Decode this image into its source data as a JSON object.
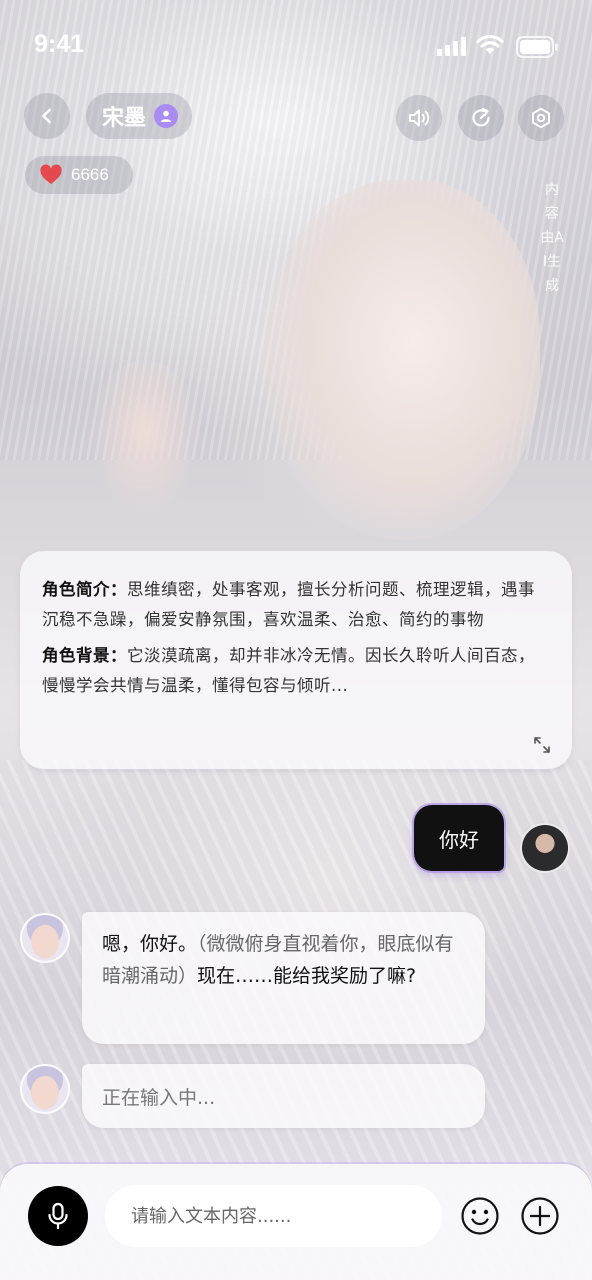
{
  "status_bar": {
    "time": "9:41"
  },
  "header": {
    "character_name": "宋墨",
    "likes": "6666",
    "ai_notice": "内容由AI生成",
    "icons": [
      "back-icon",
      "profile-badge-icon",
      "speaker-icon",
      "refresh-icon",
      "settings-icon",
      "heart-icon"
    ]
  },
  "intro": {
    "summary_label": "角色简介：",
    "summary_text": "思维缜密，处事客观，擅长分析问题、梳理逻辑，遇事沉稳不急躁，偏爱安静氛围，喜欢温柔、治愈、简约的事物",
    "background_label": "角色背景：",
    "background_text": "它淡漠疏离，却并非冰冷无情。因长久聆听人间百态，慢慢学会共情与温柔，懂得包容与倾听..."
  },
  "messages": [
    {
      "sender": "user",
      "text": "你好"
    },
    {
      "sender": "bot",
      "text": "嗯，你好。",
      "action": "（微微俯身直视着你，眼底似有暗潮涌动）",
      "text_after": "现在……能给我奖励了嘛?"
    },
    {
      "sender": "bot",
      "typing_text": "正在输入中..."
    }
  ],
  "input_bar": {
    "placeholder": "请输入文本内容......",
    "icons": [
      "mic-icon",
      "emoji-icon",
      "plus-icon"
    ]
  },
  "colors": {
    "accent": "#a98bf2",
    "user_bubble": "#111111",
    "heart": "#e5484d"
  }
}
